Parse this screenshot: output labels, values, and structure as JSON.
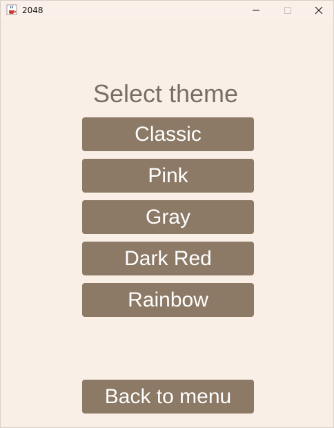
{
  "window": {
    "title": "2048",
    "icon": "java-cup-icon"
  },
  "titlebar_controls": {
    "minimize_icon": "minimize-icon",
    "maximize_icon": "maximize-icon",
    "close_icon": "close-icon"
  },
  "screen": {
    "heading": "Select theme",
    "themes": [
      {
        "label": "Classic"
      },
      {
        "label": "Pink"
      },
      {
        "label": "Gray"
      },
      {
        "label": "Dark Red"
      },
      {
        "label": "Rainbow"
      }
    ],
    "back_label": "Back to menu"
  },
  "colors": {
    "background": "#faefe6",
    "button": "#8c7966",
    "button_text": "#ffffff",
    "heading_text": "#776e65"
  }
}
